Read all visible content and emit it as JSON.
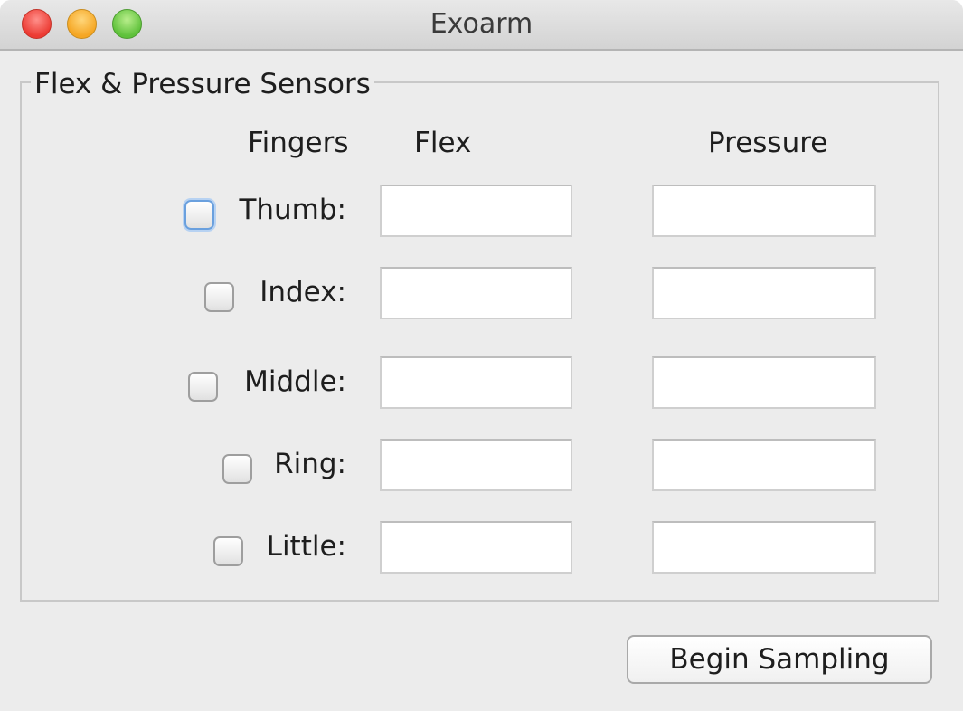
{
  "window": {
    "title": "Exoarm"
  },
  "panel": {
    "legend": "Flex & Pressure Sensors",
    "headers": {
      "fingers": "Fingers",
      "flex": "Flex",
      "pressure": "Pressure"
    },
    "rows": [
      {
        "label": "Thumb:",
        "checked": false,
        "focused": true,
        "flex": "",
        "pressure": ""
      },
      {
        "label": "Index:",
        "checked": false,
        "focused": false,
        "flex": "",
        "pressure": ""
      },
      {
        "label": "Middle:",
        "checked": false,
        "focused": false,
        "flex": "",
        "pressure": ""
      },
      {
        "label": "Ring:",
        "checked": false,
        "focused": false,
        "flex": "",
        "pressure": ""
      },
      {
        "label": "Little:",
        "checked": false,
        "focused": false,
        "flex": "",
        "pressure": ""
      }
    ]
  },
  "actions": {
    "begin_label": "Begin Sampling"
  }
}
